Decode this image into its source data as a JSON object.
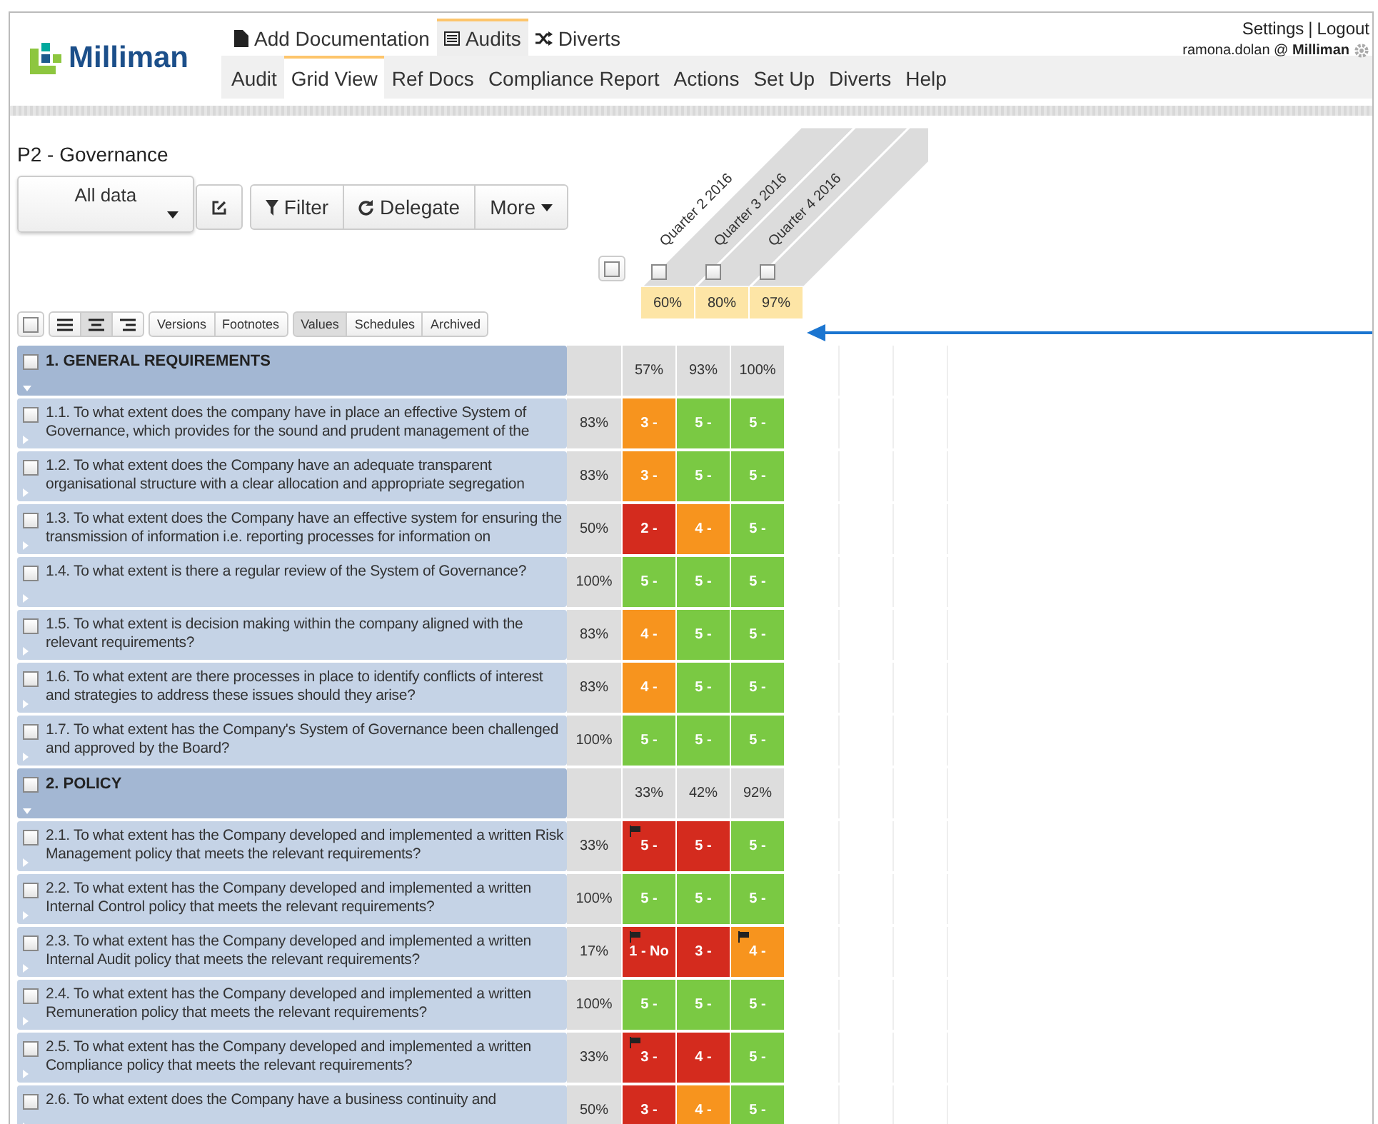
{
  "logo": {
    "text": "Milliman"
  },
  "tabs": [
    {
      "label": "Add Documentation",
      "selected": false
    },
    {
      "label": "Audits",
      "selected": true
    },
    {
      "label": "Diverts",
      "selected": false
    }
  ],
  "subtabs": [
    {
      "label": "Audit",
      "selected": false
    },
    {
      "label": "Grid View",
      "selected": true
    },
    {
      "label": "Ref Docs",
      "selected": false
    },
    {
      "label": "Compliance Report",
      "selected": false
    },
    {
      "label": "Actions",
      "selected": false
    },
    {
      "label": "Set Up",
      "selected": false
    },
    {
      "label": "Diverts",
      "selected": false
    },
    {
      "label": "Help",
      "selected": false
    }
  ],
  "account": {
    "links": [
      "Settings",
      "Logout"
    ],
    "separator": "|",
    "user": "ramona.dolan @ **Milliman**"
  },
  "page": {
    "title": "P2 - Governance",
    "view_select": "All data",
    "buttons": [
      "Filter",
      "Delegate",
      "More"
    ]
  },
  "toolbar": {
    "checked": false,
    "align": [
      {
        "kind": "left",
        "selected": false
      },
      {
        "kind": "center",
        "selected": true
      },
      {
        "kind": "right",
        "selected": false
      }
    ],
    "groups": [
      [
        {
          "label": "Versions",
          "selected": false
        },
        {
          "label": "Footnotes",
          "selected": false
        }
      ],
      [
        {
          "label": "Values",
          "selected": true
        },
        {
          "label": "Schedules",
          "selected": false
        },
        {
          "label": "Archived",
          "selected": false
        }
      ]
    ]
  },
  "percent_column": {
    "checked": false
  },
  "columns": [
    {
      "label": "Quarter 2 2016",
      "checked": false,
      "total": "60%"
    },
    {
      "label": "Quarter 3 2016",
      "checked": false,
      "total": "80%"
    },
    {
      "label": "Quarter 4 2016",
      "checked": false,
      "total": "97%"
    }
  ],
  "sections": [
    {
      "title": "1. GENERAL REQUIREMENTS",
      "checked": false,
      "expanded": true,
      "scores": [
        "57%",
        "93%",
        "100%"
      ],
      "items": [
        {
          "text": "1.1. To what extent does the company have in place an effective System of Governance, which provides for the sound and prudent management of the",
          "checked": false,
          "expanded": false,
          "percent": "83%",
          "cells": [
            {
              "value": "3 -",
              "color": "#f7941e",
              "flagged": false
            },
            {
              "value": "5 -",
              "color": "#7ac943",
              "flagged": false
            },
            {
              "value": "5 -",
              "color": "#7ac943",
              "flagged": false
            }
          ]
        },
        {
          "text": "1.2. To what extent does the Company have an adequate transparent organisational structure with a clear allocation and appropriate segregation",
          "checked": false,
          "expanded": false,
          "percent": "83%",
          "cells": [
            {
              "value": "3 -",
              "color": "#f7941e",
              "flagged": false
            },
            {
              "value": "5 -",
              "color": "#7ac943",
              "flagged": false
            },
            {
              "value": "5 -",
              "color": "#7ac943",
              "flagged": false
            }
          ]
        },
        {
          "text": "1.3. To what extent does the Company have an effective system for ensuring the transmission of information i.e. reporting processes for information on",
          "checked": false,
          "expanded": false,
          "percent": "50%",
          "cells": [
            {
              "value": "2 -",
              "color": "#d42b1e",
              "flagged": false
            },
            {
              "value": "4 -",
              "color": "#f7941e",
              "flagged": false
            },
            {
              "value": "5 -",
              "color": "#7ac943",
              "flagged": false
            }
          ]
        },
        {
          "text": "1.4. To what extent is there a regular review of the System of Governance?",
          "checked": false,
          "expanded": false,
          "percent": "100%",
          "cells": [
            {
              "value": "5 -",
              "color": "#7ac943",
              "flagged": false
            },
            {
              "value": "5 -",
              "color": "#7ac943",
              "flagged": false
            },
            {
              "value": "5 -",
              "color": "#7ac943",
              "flagged": false
            }
          ]
        },
        {
          "text": "1.5. To what extent is decision making within the company aligned with the relevant requirements?",
          "checked": false,
          "expanded": false,
          "percent": "83%",
          "cells": [
            {
              "value": "4 -",
              "color": "#f7941e",
              "flagged": false
            },
            {
              "value": "5 -",
              "color": "#7ac943",
              "flagged": false
            },
            {
              "value": "5 -",
              "color": "#7ac943",
              "flagged": false
            }
          ]
        },
        {
          "text": "1.6. To what extent are there processes in place to identify conflicts of interest and strategies to address these issues should they arise?",
          "checked": false,
          "expanded": false,
          "percent": "83%",
          "cells": [
            {
              "value": "4 -",
              "color": "#f7941e",
              "flagged": false
            },
            {
              "value": "5 -",
              "color": "#7ac943",
              "flagged": false
            },
            {
              "value": "5 -",
              "color": "#7ac943",
              "flagged": false
            }
          ]
        },
        {
          "text": "1.7. To what extent has the Company's System of Governance been challenged and approved by the Board?",
          "checked": false,
          "expanded": false,
          "percent": "100%",
          "cells": [
            {
              "value": "5 -",
              "color": "#7ac943",
              "flagged": false
            },
            {
              "value": "5 -",
              "color": "#7ac943",
              "flagged": false
            },
            {
              "value": "5 -",
              "color": "#7ac943",
              "flagged": false
            }
          ]
        }
      ]
    },
    {
      "title": "2. POLICY",
      "checked": false,
      "expanded": true,
      "scores": [
        "33%",
        "42%",
        "92%"
      ],
      "items": [
        {
          "text": "2.1. To what extent has the Company developed and implemented a written Risk Management policy that meets the relevant requirements?",
          "checked": false,
          "expanded": false,
          "percent": "33%",
          "cells": [
            {
              "value": "5 -",
              "color": "#d42b1e",
              "flagged": true
            },
            {
              "value": "5 -",
              "color": "#d42b1e",
              "flagged": false
            },
            {
              "value": "5 -",
              "color": "#7ac943",
              "flagged": false
            }
          ]
        },
        {
          "text": "2.2. To what extent has the Company developed and implemented a written Internal Control policy that meets the relevant requirements?",
          "checked": false,
          "expanded": false,
          "percent": "100%",
          "cells": [
            {
              "value": "5 -",
              "color": "#7ac943",
              "flagged": false
            },
            {
              "value": "5 -",
              "color": "#7ac943",
              "flagged": false
            },
            {
              "value": "5 -",
              "color": "#7ac943",
              "flagged": false
            }
          ]
        },
        {
          "text": "2.3. To what extent has the Company developed and implemented a written Internal Audit policy that meets the relevant requirements?",
          "checked": false,
          "expanded": false,
          "percent": "17%",
          "cells": [
            {
              "value": "1 - No",
              "color": "#d42b1e",
              "flagged": true
            },
            {
              "value": "3 -",
              "color": "#d42b1e",
              "flagged": false
            },
            {
              "value": "4 -",
              "color": "#f7941e",
              "flagged": true
            }
          ]
        },
        {
          "text": "2.4. To what extent has the Company developed and implemented a written Remuneration policy that meets the relevant requirements?",
          "checked": false,
          "expanded": false,
          "percent": "100%",
          "cells": [
            {
              "value": "5 -",
              "color": "#7ac943",
              "flagged": false
            },
            {
              "value": "5 -",
              "color": "#7ac943",
              "flagged": false
            },
            {
              "value": "5 -",
              "color": "#7ac943",
              "flagged": false
            }
          ]
        },
        {
          "text": "2.5. To what extent has the Company developed and implemented a written Compliance policy that meets the relevant requirements?",
          "checked": false,
          "expanded": false,
          "percent": "33%",
          "cells": [
            {
              "value": "3 -",
              "color": "#d42b1e",
              "flagged": true
            },
            {
              "value": "4 -",
              "color": "#d42b1e",
              "flagged": false
            },
            {
              "value": "5 -",
              "color": "#7ac943",
              "flagged": false
            }
          ]
        },
        {
          "text": "2.6. To what extent does the Company have a business continuity and",
          "checked": false,
          "expanded": false,
          "percent": "50%",
          "cells": [
            {
              "value": "3 -",
              "color": "#d42b1e",
              "flagged": false
            },
            {
              "value": "4 -",
              "color": "#f7941e",
              "flagged": false
            },
            {
              "value": "5 -",
              "color": "#7ac943",
              "flagged": false
            }
          ]
        }
      ]
    }
  ]
}
